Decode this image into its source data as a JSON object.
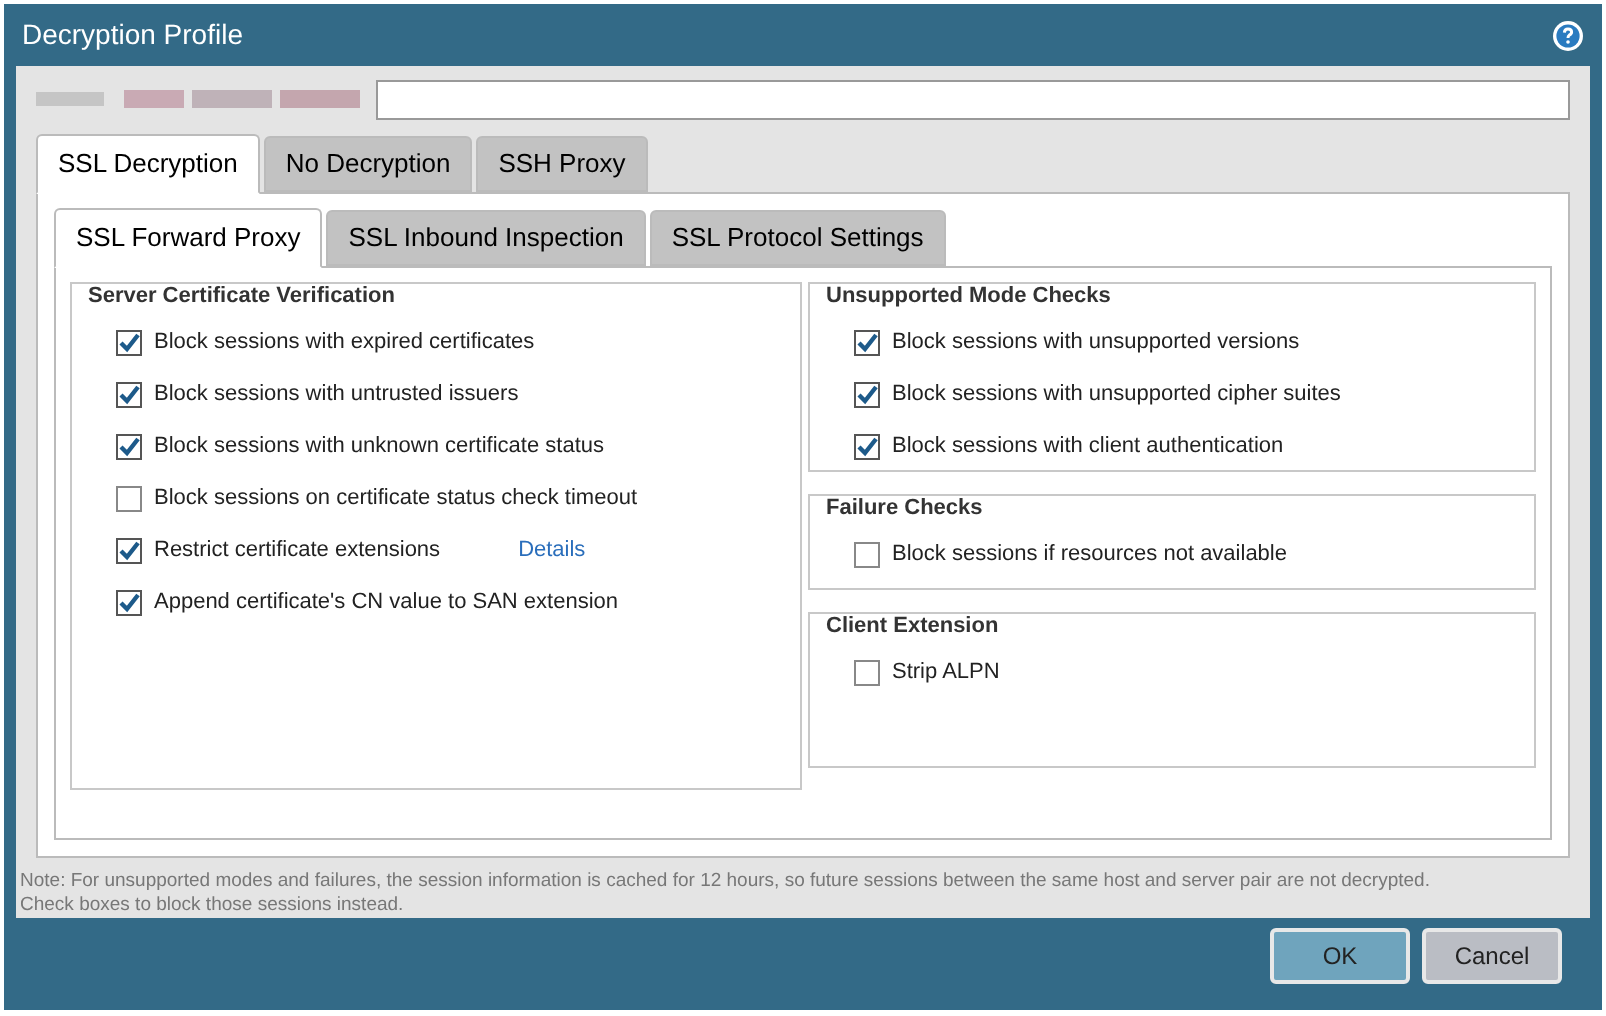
{
  "window": {
    "title": "Decryption Profile"
  },
  "tabs": [
    {
      "label": "SSL Decryption",
      "selected": true
    },
    {
      "label": "No Decryption",
      "selected": false
    },
    {
      "label": "SSH Proxy",
      "selected": false
    }
  ],
  "subtabs": [
    {
      "label": "SSL Forward Proxy",
      "selected": true
    },
    {
      "label": "SSL Inbound Inspection",
      "selected": false
    },
    {
      "label": "SSL Protocol Settings",
      "selected": false
    }
  ],
  "left_group": {
    "title": "Server Certificate Verification",
    "options": [
      {
        "label": "Block sessions with expired certificates",
        "checked": true
      },
      {
        "label": "Block sessions with untrusted issuers",
        "checked": true
      },
      {
        "label": "Block sessions with unknown certificate status",
        "checked": true
      },
      {
        "label": "Block sessions on certificate status check timeout",
        "checked": false
      },
      {
        "label": "Restrict certificate extensions",
        "checked": true,
        "link": "Details"
      },
      {
        "label": "Append certificate's CN value to SAN extension",
        "checked": true
      }
    ]
  },
  "right_groups": [
    {
      "title": "Unsupported Mode Checks",
      "options": [
        {
          "label": "Block sessions with unsupported versions",
          "checked": true
        },
        {
          "label": "Block sessions with unsupported cipher suites",
          "checked": true
        },
        {
          "label": "Block sessions with client authentication",
          "checked": true
        }
      ]
    },
    {
      "title": "Failure Checks",
      "options": [
        {
          "label": "Block sessions if resources not available",
          "checked": false
        }
      ]
    },
    {
      "title": "Client Extension",
      "options": [
        {
          "label": "Strip ALPN",
          "checked": false
        }
      ]
    }
  ],
  "note": "Note: For unsupported modes and failures, the session information is cached for 12 hours, so future sessions between the same host and server pair are not decrypted. Check boxes to block those sessions instead.",
  "buttons": [
    {
      "label": "OK",
      "kind": "primary"
    },
    {
      "label": "Cancel",
      "kind": "secondary"
    }
  ]
}
